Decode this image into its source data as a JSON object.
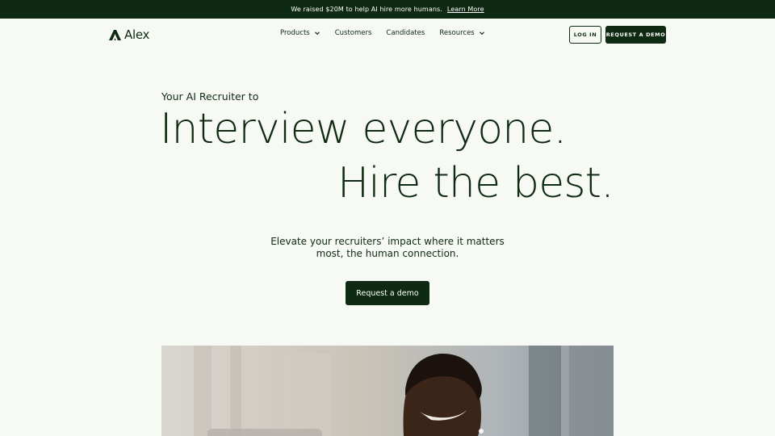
{
  "banner": {
    "text": "We raised $20M to help AI hire more humans.",
    "link": "Learn More"
  },
  "nav": {
    "logo_text": "Alex",
    "items": [
      {
        "label": "Products",
        "has_dropdown": true
      },
      {
        "label": "Customers",
        "has_dropdown": false
      },
      {
        "label": "Candidates",
        "has_dropdown": false
      },
      {
        "label": "Resources",
        "has_dropdown": true
      }
    ],
    "login_label": "LOG IN",
    "demo_label": "REQUEST A DEMO"
  },
  "hero": {
    "eyebrow": "Your AI Recruiter to",
    "headline_line1": "Interview everyone.",
    "headline_line2": "Hire the best.",
    "subcopy": "Elevate your recruiters’ impact where it matters most, the human connection.",
    "cta_label": "Request a demo"
  },
  "colors": {
    "brand_dark": "#0f2a12",
    "background": "#f7f9f5",
    "button_text": "#ffffff"
  },
  "icons": {
    "logo": "alex-logo-icon",
    "dropdown": "chevron-down-icon"
  }
}
